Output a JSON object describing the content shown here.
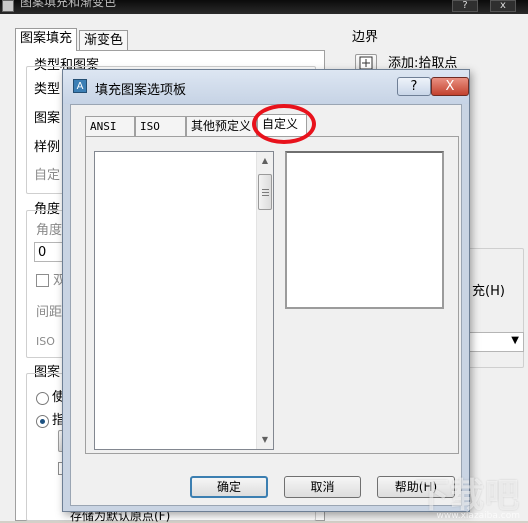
{
  "parent_window": {
    "title": "图案填充和渐变色",
    "title_buttons": [
      "?",
      "x"
    ],
    "tabs": [
      "图案填充",
      "渐变色"
    ],
    "left": {
      "section_type": "类型和图案",
      "type_label": "类型",
      "pattern_label": "图案",
      "sample_label": "样例",
      "custom_label": "自定",
      "section_angle": "角度",
      "angle_label": "角度",
      "angle_value": "0",
      "double_label": "双",
      "spacing_label": "间距",
      "iso_label": "ISO",
      "section_origin": "图案",
      "radio_use_label": "使",
      "radio_specify_label": "指",
      "store_default_button": "存储为默认原点(F)"
    },
    "right": {
      "section_boundary": "边界",
      "add_pick_points": "添加:拾取点",
      "fill_partial": "充(H)"
    }
  },
  "palette_dialog": {
    "title": "填充图案选项板",
    "help_button": "?",
    "close_button": "X",
    "tabs": [
      "ANSI",
      "ISO",
      "其他预定义",
      "自定义"
    ],
    "active_tab": "自定义",
    "buttons": {
      "ok": "确定",
      "cancel": "取消",
      "help": "帮助(H)"
    }
  },
  "annotation": {
    "highlight_color": "#e8121c",
    "highlighted_tab": "自定义"
  },
  "watermark": {
    "text": "下载吧",
    "url": "www.xiazaiba.com"
  }
}
